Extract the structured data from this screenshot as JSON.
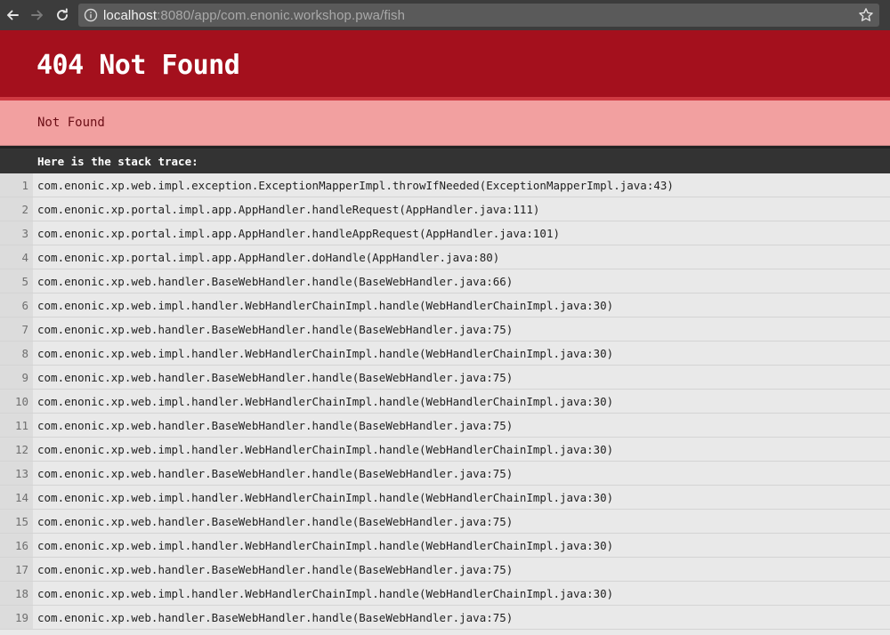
{
  "browser": {
    "url_host": "localhost",
    "url_rest": ":8080/app/com.enonic.workshop.pwa/fish",
    "icons": {
      "back": "back-arrow-icon",
      "forward": "forward-arrow-icon",
      "reload": "reload-icon",
      "info": "info-icon",
      "bookmark": "star-icon"
    }
  },
  "error": {
    "title": "404 Not Found",
    "message": "Not Found",
    "trace_heading": "Here is the stack trace:"
  },
  "stack_trace": [
    {
      "line": "1",
      "frame": "com.enonic.xp.web.impl.exception.ExceptionMapperImpl.throwIfNeeded(ExceptionMapperImpl.java:43)"
    },
    {
      "line": "2",
      "frame": "com.enonic.xp.portal.impl.app.AppHandler.handleRequest(AppHandler.java:111)"
    },
    {
      "line": "3",
      "frame": "com.enonic.xp.portal.impl.app.AppHandler.handleAppRequest(AppHandler.java:101)"
    },
    {
      "line": "4",
      "frame": "com.enonic.xp.portal.impl.app.AppHandler.doHandle(AppHandler.java:80)"
    },
    {
      "line": "5",
      "frame": "com.enonic.xp.web.handler.BaseWebHandler.handle(BaseWebHandler.java:66)"
    },
    {
      "line": "6",
      "frame": "com.enonic.xp.web.impl.handler.WebHandlerChainImpl.handle(WebHandlerChainImpl.java:30)"
    },
    {
      "line": "7",
      "frame": "com.enonic.xp.web.handler.BaseWebHandler.handle(BaseWebHandler.java:75)"
    },
    {
      "line": "8",
      "frame": "com.enonic.xp.web.impl.handler.WebHandlerChainImpl.handle(WebHandlerChainImpl.java:30)"
    },
    {
      "line": "9",
      "frame": "com.enonic.xp.web.handler.BaseWebHandler.handle(BaseWebHandler.java:75)"
    },
    {
      "line": "10",
      "frame": "com.enonic.xp.web.impl.handler.WebHandlerChainImpl.handle(WebHandlerChainImpl.java:30)"
    },
    {
      "line": "11",
      "frame": "com.enonic.xp.web.handler.BaseWebHandler.handle(BaseWebHandler.java:75)"
    },
    {
      "line": "12",
      "frame": "com.enonic.xp.web.impl.handler.WebHandlerChainImpl.handle(WebHandlerChainImpl.java:30)"
    },
    {
      "line": "13",
      "frame": "com.enonic.xp.web.handler.BaseWebHandler.handle(BaseWebHandler.java:75)"
    },
    {
      "line": "14",
      "frame": "com.enonic.xp.web.impl.handler.WebHandlerChainImpl.handle(WebHandlerChainImpl.java:30)"
    },
    {
      "line": "15",
      "frame": "com.enonic.xp.web.handler.BaseWebHandler.handle(BaseWebHandler.java:75)"
    },
    {
      "line": "16",
      "frame": "com.enonic.xp.web.impl.handler.WebHandlerChainImpl.handle(WebHandlerChainImpl.java:30)"
    },
    {
      "line": "17",
      "frame": "com.enonic.xp.web.handler.BaseWebHandler.handle(BaseWebHandler.java:75)"
    },
    {
      "line": "18",
      "frame": "com.enonic.xp.web.impl.handler.WebHandlerChainImpl.handle(WebHandlerChainImpl.java:30)"
    },
    {
      "line": "19",
      "frame": "com.enonic.xp.web.handler.BaseWebHandler.handle(BaseWebHandler.java:75)"
    }
  ],
  "colors": {
    "header_bg": "#a4101d",
    "message_bg": "#f2a0a0",
    "trace_header_bg": "#333333",
    "trace_bg": "#e9e9e9"
  }
}
